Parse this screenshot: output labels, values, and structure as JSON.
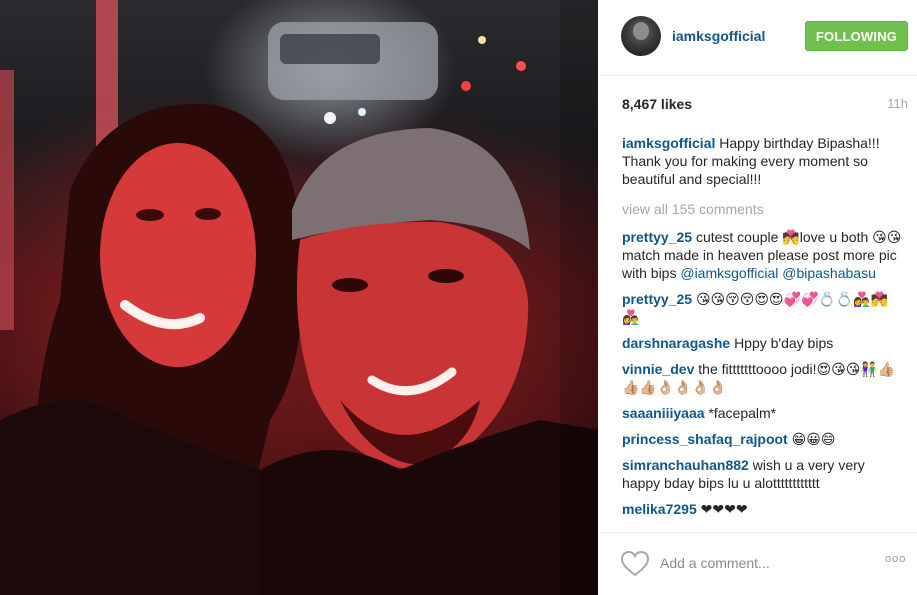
{
  "post": {
    "username": "iamksgofficial",
    "follow_label": "FOLLOWING",
    "likes": "8,467 likes",
    "time": "11h",
    "view_all": "view all 155 comments",
    "add_comment_placeholder": "Add a comment...",
    "more_label": "ooo"
  },
  "caption": {
    "user": "iamksgofficial",
    "text": "Happy birthday Bipasha!!! Thank you for making every moment so beautiful and special!!!"
  },
  "comments": [
    {
      "user": "prettyy_25",
      "text": "cutest couple 💏love u both 😘😘match made in heaven please post more pic with bips",
      "mentions": [
        "@iamksgofficial",
        "@bipashabasu"
      ]
    },
    {
      "user": "prettyy_25",
      "text": "😘😘😚😚😍😍💞💞💍💍👩‍❤️‍👨💏👩‍❤️‍👨"
    },
    {
      "user": "darshnaragashe",
      "text": "Hppy b'day bips"
    },
    {
      "user": "vinnie_dev",
      "text": "the fitttttttoooo jodi!😍😘😘👫👍🏼👍🏼👍🏼👌🏼👌🏼👌🏼👌🏼"
    },
    {
      "user": "saaaniiiyaaa",
      "text": "*facepalm*"
    },
    {
      "user": "princess_shafaq_rajpoot",
      "text": "😁😀😄"
    },
    {
      "user": "simranchauhan882",
      "text": "wish u a very very happy bday bips lu u alotttttttttttt"
    },
    {
      "user": "melika7295",
      "text": "❤❤❤❤"
    }
  ],
  "colors": {
    "username_blue": "#125688",
    "follow_green": "#70c050",
    "muted_gray": "#a5a7aa"
  },
  "icons": {
    "like": "heart-outline-icon",
    "more": "more-options-icon"
  }
}
